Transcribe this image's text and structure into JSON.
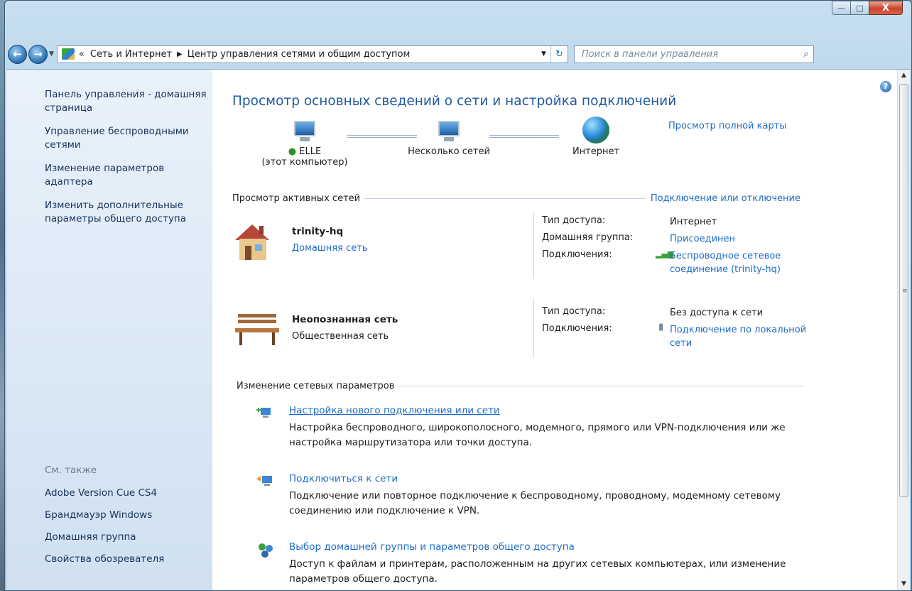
{
  "window": {
    "minimize": "—",
    "maximize": "□",
    "close": "X"
  },
  "navbar": {
    "back": "←",
    "forward": "→",
    "history_dropdown": "▼",
    "address_prefix": "«",
    "breadcrumb": [
      "Сеть и Интернет",
      "Центр управления сетями и общим доступом"
    ],
    "separator": "▶",
    "address_dropdown": "▼",
    "refresh": "↻",
    "search_placeholder": "Поиск в панели управления",
    "search_icon": "⌕"
  },
  "sidebar": {
    "items": [
      "Панель управления - домашняя страница",
      "Управление беспроводными сетями",
      "Изменение параметров адаптера",
      "Изменить дополнительные параметры общего доступа"
    ],
    "see_also_title": "См. также",
    "see_also": [
      "Adobe Version Cue CS4",
      "Брандмауэр Windows",
      "Домашняя группа",
      "Свойства обозревателя"
    ]
  },
  "main": {
    "help": "?",
    "title": "Просмотр основных сведений о сети и настройка подключений",
    "full_map_link": "Просмотр полной карты",
    "map": {
      "computer_name": "ELLE",
      "computer_sub": "(этот компьютер)",
      "middle": "Несколько сетей",
      "internet": "Интернет"
    },
    "active_networks_title": "Просмотр активных сетей",
    "connect_disconnect": "Подключение или отключение",
    "networks": [
      {
        "name": "trinity-hq",
        "type": "Домашняя сеть",
        "access_type_label": "Тип доступа:",
        "access_type": "Интернет",
        "homegroup_label": "Домашняя группа:",
        "homegroup": "Присоединен",
        "connections_label": "Подключения:",
        "connection": "Беспроводное сетевое соединение (trinity-hq)"
      },
      {
        "name": "Неопознанная сеть",
        "type": "Общественная сеть",
        "access_type_label": "Тип доступа:",
        "access_type": "Без доступа к сети",
        "connections_label": "Подключения:",
        "connection": "Подключение по локальной сети"
      }
    ],
    "change_settings_title": "Изменение сетевых параметров",
    "tasks": [
      {
        "link": "Настройка нового подключения или сети",
        "desc": "Настройка беспроводного, широкополосного, модемного, прямого или VPN-подключения или же настройка маршрутизатора или точки доступа."
      },
      {
        "link": "Подключиться к сети",
        "desc": "Подключение или повторное подключение к беспроводному, проводному, модемному сетевому соединению или подключение к VPN."
      },
      {
        "link": "Выбор домашней группы и параметров общего доступа",
        "desc": "Доступ к файлам и принтерам, расположенным на других сетевых компьютерах, или изменение параметров общего доступа."
      }
    ]
  },
  "scrollbar": {
    "up": "▲",
    "down": "▼",
    "grip": "≡"
  },
  "colors": {
    "link": "#1d6cc7",
    "title": "#1e5aa0",
    "sidebar_bg": "#dbe8f5"
  }
}
